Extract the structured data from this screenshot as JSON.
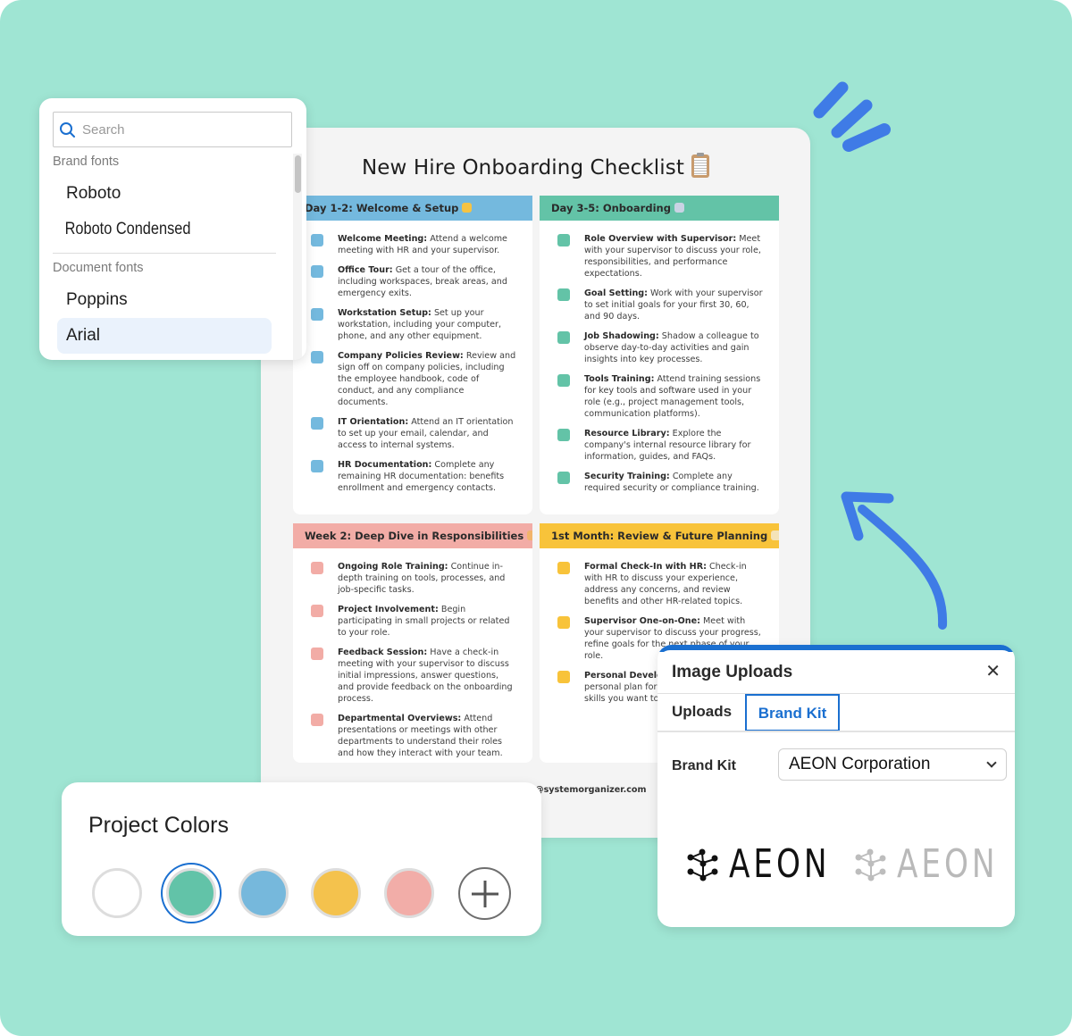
{
  "font_picker": {
    "search_placeholder": "Search",
    "groups": [
      {
        "label": "Brand fonts",
        "fonts": [
          "Roboto",
          "Roboto Condensed"
        ]
      },
      {
        "label": "Document fonts",
        "fonts": [
          "Poppins",
          "Arial"
        ]
      }
    ],
    "selected_font": "Arial"
  },
  "document": {
    "title": "New Hire Onboarding Checklist",
    "title_icon": "clipboard-icon",
    "footer": "@systemorganizer.com",
    "sections": [
      {
        "heading": "Day 1-2: Welcome & Setup",
        "emoji": "waving-hand-icon",
        "color": "#74b9de",
        "items": [
          {
            "title": "Welcome Meeting:",
            "text": " Attend a welcome meeting with HR and your supervisor."
          },
          {
            "title": "Office Tour:",
            "text": " Get a tour of the office, including workspaces, break areas, and emergency exits."
          },
          {
            "title": "Workstation Setup:",
            "text": " Set up your workstation, including your computer, phone, and any other equipment."
          },
          {
            "title": "Company Policies Review:",
            "text": " Review and sign off on company policies, including the employee handbook, code of conduct, and any compliance documents."
          },
          {
            "title": "IT Orientation:",
            "text": " Attend an IT orientation to set up your email, calendar, and access to internal systems."
          },
          {
            "title": "HR Documentation:",
            "text": " Complete any remaining HR documentation: benefits enrollment and emergency contacts."
          }
        ]
      },
      {
        "heading": "Day 3-5: Onboarding",
        "emoji": "rocket-icon",
        "color": "#63c3a7",
        "items": [
          {
            "title": "Role Overview with Supervisor:",
            "text": " Meet with your supervisor to discuss your role, responsibilities, and performance expectations."
          },
          {
            "title": "Goal Setting:",
            "text": " Work with your supervisor to set initial goals for your first 30, 60, and 90 days."
          },
          {
            "title": "Job Shadowing:",
            "text": " Shadow a colleague to observe day-to-day activities and gain insights into key processes."
          },
          {
            "title": "Tools Training:",
            "text": " Attend training sessions for key tools and software used in your role (e.g., project management tools, communication platforms)."
          },
          {
            "title": "Resource Library:",
            "text": " Explore the company's internal resource library for information, guides, and FAQs."
          },
          {
            "title": "Security Training:",
            "text": " Complete any required security or compliance training."
          }
        ]
      },
      {
        "heading": "Week 2: Deep Dive in Responsibilities",
        "emoji": "magnifier-icon",
        "color": "#f2aca6",
        "items": [
          {
            "title": "Ongoing Role Training:",
            "text": " Continue in-depth training on tools, processes, and job-specific tasks."
          },
          {
            "title": "Project Involvement:",
            "text": " Begin participating in small projects or related to your role."
          },
          {
            "title": "Feedback Session:",
            "text": " Have a check-in meeting with your supervisor to discuss initial impressions, answer questions, and provide feedback on the onboarding process."
          },
          {
            "title": "Departmental Overviews:",
            "text": " Attend presentations or meetings with other departments to understand their roles and how they interact with your team."
          }
        ]
      },
      {
        "heading": "1st Month: Review & Future Planning",
        "emoji": "memo-icon",
        "color": "#f8c33a",
        "items": [
          {
            "title": "Formal Check-In with HR:",
            "text": " Check-in with HR to discuss your experience, address any concerns, and review benefits and other HR-related topics."
          },
          {
            "title": "Supervisor One-on-One:",
            "text": " Meet with your supervisor to discuss your progress, refine goals for the next phase of your role."
          },
          {
            "title": "Personal Development:",
            "text": " outlining a personal plan for the next six months, skills you want to learn, want to improve."
          }
        ]
      }
    ]
  },
  "project_colors": {
    "title": "Project Colors",
    "swatches": [
      {
        "name": "white",
        "hex": "#ffffff",
        "selected": false
      },
      {
        "name": "green",
        "hex": "#62c3a8",
        "selected": true
      },
      {
        "name": "blue",
        "hex": "#76b8dc",
        "selected": false
      },
      {
        "name": "yellow",
        "hex": "#f4c24d",
        "selected": false
      },
      {
        "name": "pink",
        "hex": "#f2ada8",
        "selected": false
      }
    ],
    "add_label": "+"
  },
  "image_uploads": {
    "title": "Image Uploads",
    "close_label": "✕",
    "tabs": [
      {
        "label": "Uploads",
        "active": false
      },
      {
        "label": "Brand Kit",
        "active": true
      }
    ],
    "brand_kit_label": "Brand Kit",
    "brand_kit_value": "AEON Corporation",
    "logos": [
      {
        "text": "AEON",
        "variant": "dark",
        "color": "#111111"
      },
      {
        "text": "AEON",
        "variant": "light",
        "color": "#b9b9b9"
      }
    ]
  },
  "colors": {
    "background": "#9fe5d3",
    "accent": "#1a6fd0",
    "decoration": "#3f7be6"
  }
}
